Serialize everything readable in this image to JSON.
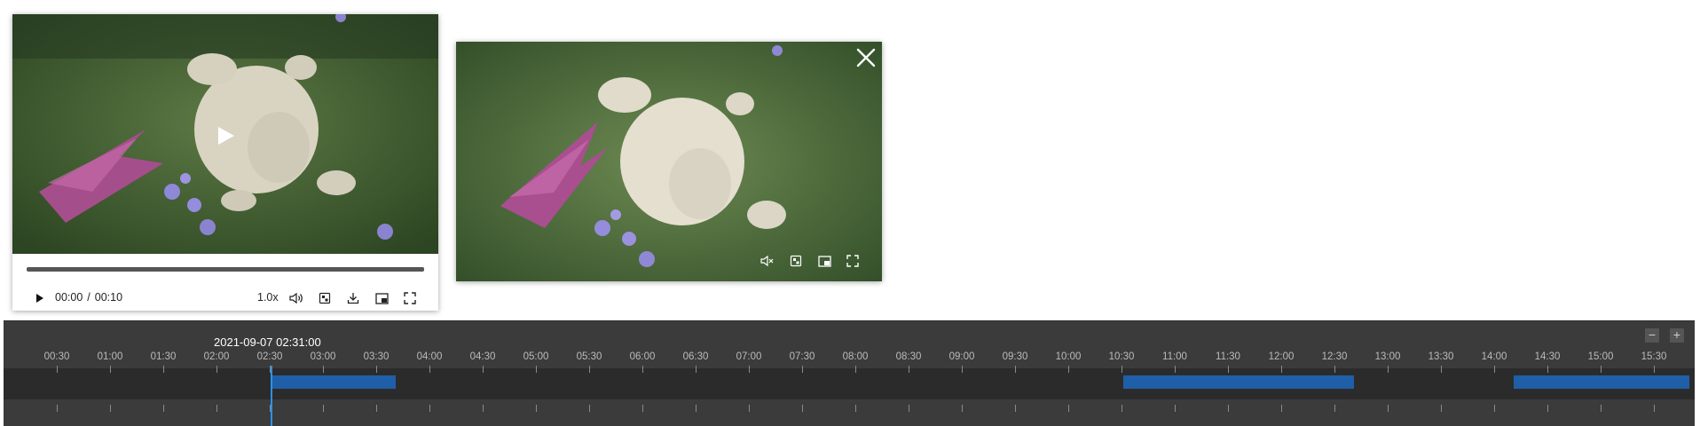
{
  "player": {
    "current_time": "00:00",
    "duration": "00:10",
    "separator": "/",
    "progress": 0,
    "speed": "1.0x"
  },
  "icons": {
    "big_play": "play-icon",
    "play": "play-icon",
    "volume": "volume-icon",
    "snapshot": "snapshot-icon",
    "download": "download-icon",
    "pip": "picture-in-picture-icon",
    "fullscreen": "fullscreen-icon",
    "close": "close-icon",
    "muted": "volume-muted-icon"
  },
  "timeline": {
    "cursor_time": "2021-09-07 02:31:00",
    "labels": [
      "00:30",
      "01:00",
      "01:30",
      "02:00",
      "02:30",
      "03:00",
      "03:30",
      "04:00",
      "04:30",
      "05:00",
      "05:30",
      "06:00",
      "06:30",
      "07:00",
      "07:30",
      "08:00",
      "08:30",
      "09:00",
      "09:30",
      "10:00",
      "10:30",
      "11:00",
      "11:30",
      "12:00",
      "12:30",
      "13:00",
      "13:30",
      "14:00",
      "14:30",
      "15:00",
      "15:30"
    ],
    "recordings": [
      {
        "start": "02:31",
        "end": "03:41"
      },
      {
        "start": "10:31",
        "end": "12:41"
      },
      {
        "start": "14:11",
        "end": "15:50"
      }
    ],
    "zoom_out": "−",
    "zoom_in": "+"
  },
  "colors": {
    "accent": "#2f8fe8",
    "recording": "#1f5fa8",
    "timeline_bg": "#3b3b3b"
  }
}
